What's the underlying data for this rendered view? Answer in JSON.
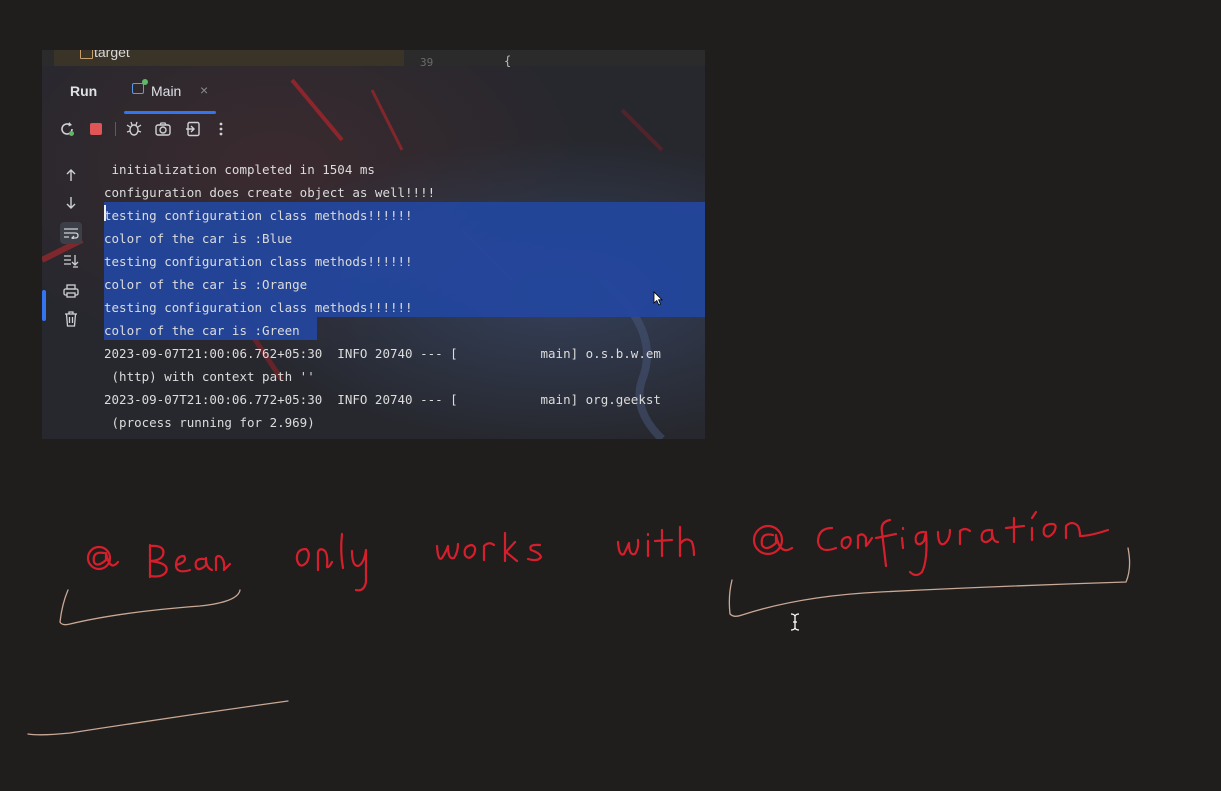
{
  "project_tree": {
    "item": "target",
    "line_number": "39",
    "code": "{"
  },
  "run_panel": {
    "title": "Run",
    "tab": {
      "label": "Main",
      "close": "×"
    }
  },
  "toolbar": {
    "buttons": [
      {
        "name": "rerun-icon"
      },
      {
        "name": "stop-icon"
      },
      {
        "name": "debug-icon"
      },
      {
        "name": "screenshot-icon"
      },
      {
        "name": "exit-icon"
      },
      {
        "name": "more-icon"
      }
    ]
  },
  "sidebar": {
    "buttons": [
      {
        "name": "scroll-up-icon"
      },
      {
        "name": "scroll-down-icon"
      },
      {
        "name": "soft-wrap-icon",
        "active": true
      },
      {
        "name": "scroll-to-end-icon"
      },
      {
        "name": "print-icon"
      },
      {
        "name": "clear-icon"
      }
    ]
  },
  "console": {
    "lines": [
      " initialization completed in 1504 ms",
      "configuration does create object as well!!!!",
      "testing configuration class methods!!!!!!",
      "color of the car is :Blue",
      "testing configuration class methods!!!!!!",
      "color of the car is :Orange",
      "testing configuration class methods!!!!!!",
      "color of the car is :Green",
      "2023-09-07T21:00:06.762+05:30  INFO 20740 --- [           main] o.s.b.w.em",
      " (http) with context path ''",
      "2023-09-07T21:00:06.772+05:30  INFO 20740 --- [           main] org.geekst",
      " (process running for 2.969)"
    ]
  },
  "annotation": {
    "words": [
      "@Bean",
      "only",
      "works",
      "with",
      "@Configuration"
    ],
    "ink_color": "#d61f2d",
    "underline_color": "#c9a895"
  },
  "colors": {
    "background": "#1f1e1c",
    "selection": "#2347a0",
    "accent": "#3574f0"
  }
}
